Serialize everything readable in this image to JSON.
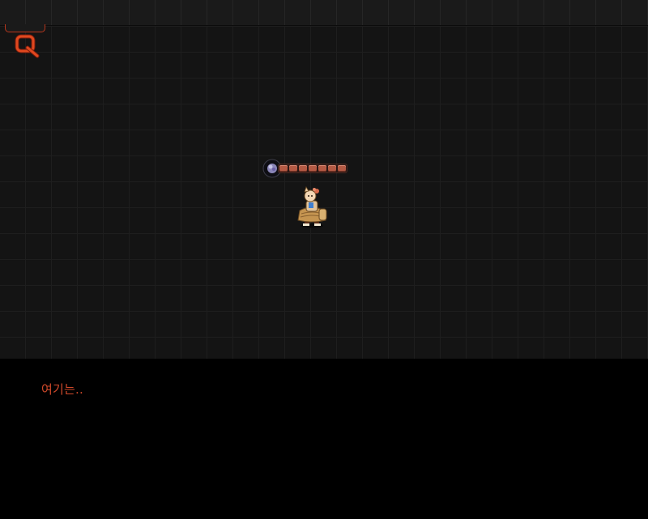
{
  "hud": {
    "quest_icon": "quest-q-icon",
    "player_hp_segments": 7,
    "accent_color": "#d0492a"
  },
  "dialogue": {
    "text": "여기는.."
  }
}
